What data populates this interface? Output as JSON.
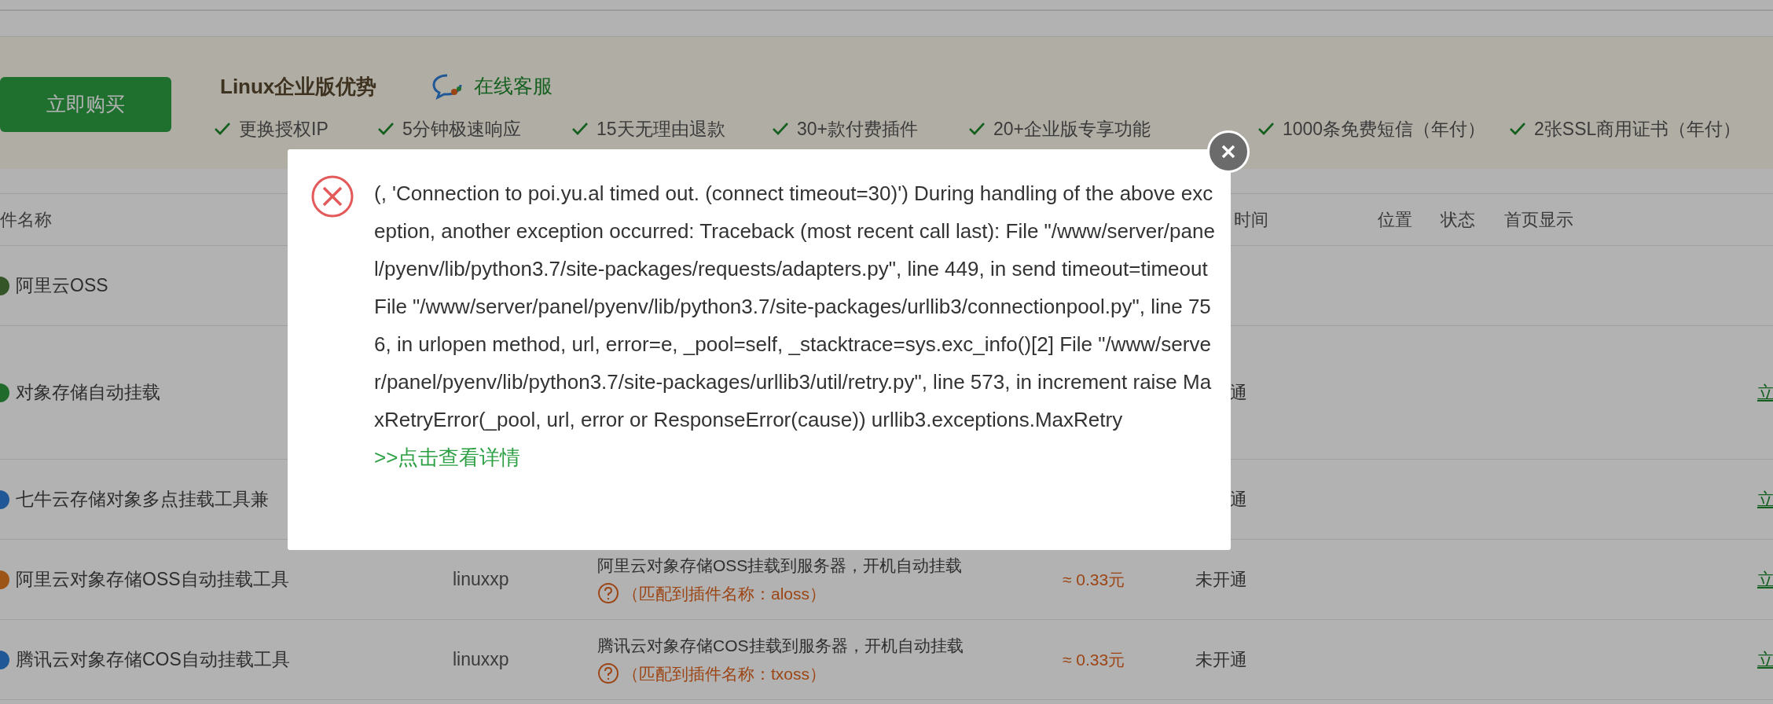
{
  "banner": {
    "buy_button": "立即购买",
    "title": "Linux企业版优势",
    "support_link": "在线客服",
    "features": [
      "更换授权IP",
      "5分钟极速响应",
      "15天无理由退款",
      "30+款付费插件",
      "20+企业版专享功能",
      "1000条免费短信（年付）",
      "2张SSL商用证书（年付）"
    ]
  },
  "table": {
    "columns": [
      "件名称",
      "时间",
      "位置",
      "状态",
      "首页显示"
    ],
    "rows": [
      {
        "name": "阿里云OSS"
      },
      {
        "name": "对象存储自动挂载",
        "status": "通",
        "action": "立"
      },
      {
        "name": "七牛云存储对象多点挂载工具兼",
        "status": "通",
        "action": "立"
      },
      {
        "name": "阿里云对象存储OSS自动挂载工具",
        "author": "linuxxp",
        "description": "阿里云对象存储OSS挂载到服务器，开机自动挂载",
        "plugin_match": "（匹配到插件名称：aloss）",
        "price": "≈ 0.33元",
        "status": "未开通",
        "action": "立"
      },
      {
        "name": "腾讯云对象存储COS自动挂载工具",
        "author": "linuxxp",
        "description": "腾讯云对象存储COS挂载到服务器，开机自动挂载",
        "plugin_match": "（匹配到插件名称：txoss）",
        "price": "≈ 0.33元",
        "status": "未开通",
        "action": "立"
      }
    ]
  },
  "dialog": {
    "message": "(, 'Connection to poi.yu.al timed out. (connect timeout=30)') During handling of the above exception, another exception occurred: Traceback (most recent call last): File \"/www/server/panel/pyenv/lib/python3.7/site-packages/requests/adapters.py\", line 449, in send timeout=timeout File \"/www/server/panel/pyenv/lib/python3.7/site-packages/urllib3/connectionpool.py\", line 756, in urlopen method, url, error=e, _pool=self, _stacktrace=sys.exc_info()[2] File \"/www/server/panel/pyenv/lib/python3.7/site-packages/urllib3/util/retry.py\", line 573, in increment raise MaxRetryError(_pool, url, error or ResponseError(cause)) urllib3.exceptions.MaxRetry",
    "details_link": ">>点击查看详情"
  }
}
